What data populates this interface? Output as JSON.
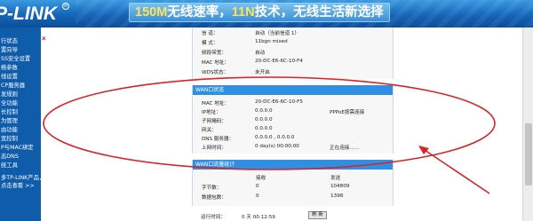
{
  "header": {
    "logo": "P-LINK",
    "logo_mark": "R",
    "slogan_a": "150M",
    "slogan_b": "无线速率，",
    "slogan_c": "11N",
    "slogan_d": "技术，无线生活新选择"
  },
  "sidebar": {
    "items": [
      "行状态",
      "置向导",
      "SS安全设置",
      "络参数",
      "线设置",
      "CP服务器",
      "发规则",
      "全功能",
      "长控制",
      "为管理",
      "由功能",
      "宽控制",
      "P与MAC绑定",
      "态DNS",
      "统工具"
    ],
    "extra": [
      "多TP-LINK产品，",
      "点击查看 >>"
    ]
  },
  "close_icon": "×",
  "wireless_info": {
    "rows": [
      {
        "label": "信  道：",
        "value": "自动（当前信道 1）"
      },
      {
        "label": "模  式：",
        "value": "11bgn mixed"
      },
      {
        "label": "频段带宽：",
        "value": "自动"
      },
      {
        "label": "MAC 地址：",
        "value": "20-DC-E6-6C-10-F4"
      },
      {
        "label": "WDS状态：",
        "value": "未开启"
      }
    ]
  },
  "wan": {
    "title": "WAN口状态",
    "rows": [
      {
        "label": "MAC 地址：",
        "value": "20-DC-E6-6C-10-F5",
        "extra": ""
      },
      {
        "label": "IP地址：",
        "value": "0.0.0.0",
        "extra": "PPPoE按需连接"
      },
      {
        "label": "子网掩码：",
        "value": "0.0.0.0",
        "extra": ""
      },
      {
        "label": "网关：",
        "value": "0.0.0.0",
        "extra": ""
      },
      {
        "label": "DNS 服务器：",
        "value": "0.0.0.0 , 0.0.0.0",
        "extra": ""
      },
      {
        "label": "上网时间：",
        "value": "0 day(s) 00:00:00",
        "extra": "正在连接……"
      }
    ]
  },
  "stats": {
    "title": "WAN口流量统计",
    "col_received": "接收",
    "col_sent": "发送",
    "rows": [
      {
        "label": "字节数：",
        "received": "0",
        "sent": "104809"
      },
      {
        "label": "数据包数：",
        "received": "0",
        "sent": "1398"
      }
    ]
  },
  "runtime": {
    "label": "运行时间：",
    "value": "0 天 00:12:59",
    "refresh_label": "刷 新"
  },
  "annotation": {
    "color": "#d8232a"
  }
}
